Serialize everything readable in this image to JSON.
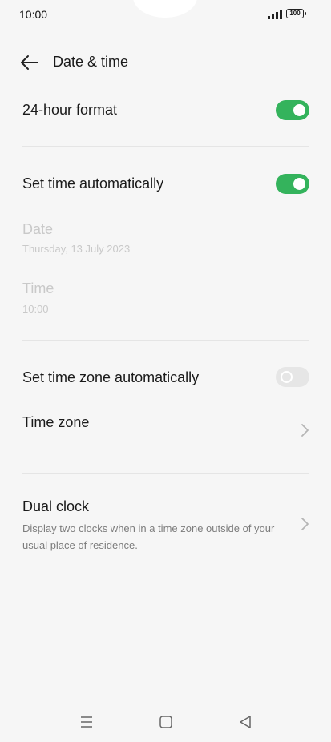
{
  "status_bar": {
    "time": "10:00",
    "battery": "100",
    "icons": [
      "signal-icon",
      "battery-icon"
    ]
  },
  "header": {
    "title": "Date & time",
    "back_icon": "back-arrow-icon"
  },
  "settings": {
    "hour_format": {
      "label": "24-hour format",
      "enabled": true
    },
    "set_time_auto": {
      "label": "Set time automatically",
      "enabled": true
    },
    "date": {
      "label": "Date",
      "value": "Thursday, 13 July 2023"
    },
    "time": {
      "label": "Time",
      "value": "10:00"
    },
    "set_zone_auto": {
      "label": "Set time zone automatically",
      "enabled": false
    },
    "time_zone": {
      "label": "Time zone"
    },
    "dual_clock": {
      "label": "Dual clock",
      "description": "Display two clocks when in a time zone outside of your usual place of residence."
    }
  },
  "colors": {
    "toggle_on": "#34b35c",
    "toggle_off": "#e6e6e6",
    "disabled_text": "#c9c9c9"
  },
  "nav_bar": {
    "icons": [
      "menu-icon",
      "home-icon",
      "back-icon"
    ]
  }
}
